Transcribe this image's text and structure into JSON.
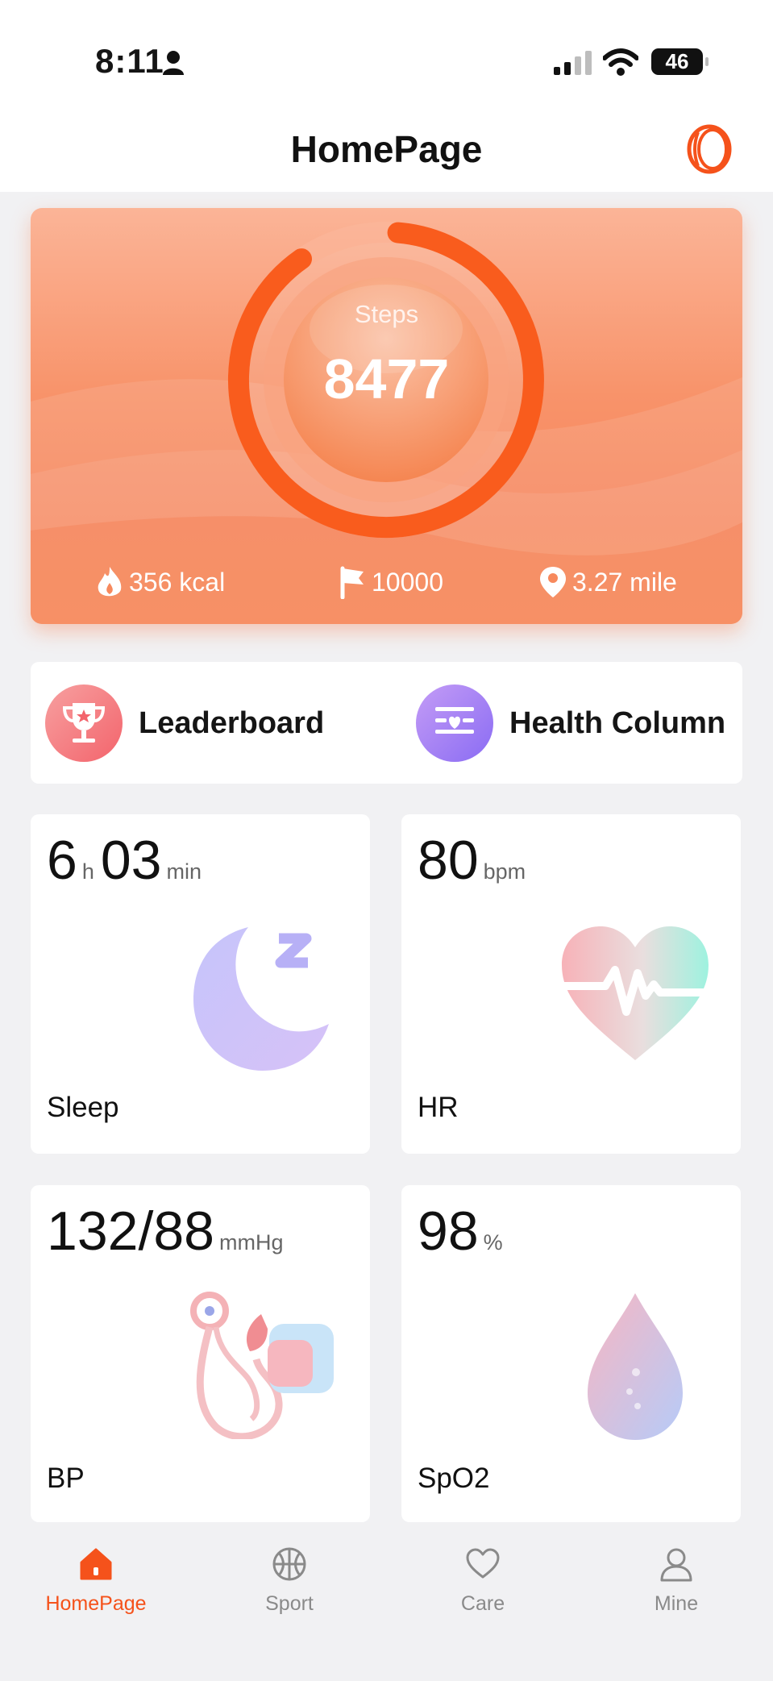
{
  "status_bar": {
    "time": "8:11",
    "battery": "46"
  },
  "header": {
    "title": "HomePage"
  },
  "steps_card": {
    "label": "Steps",
    "value": "8477",
    "goal_progress": 0.8477,
    "stats": {
      "calories": "356 kcal",
      "goal": "10000",
      "distance": "3.27 mile"
    }
  },
  "quick_links": [
    {
      "label": "Leaderboard"
    },
    {
      "label": "Health Column"
    }
  ],
  "tiles": {
    "sleep": {
      "hours": "6",
      "hours_unit": "h",
      "minutes": "03",
      "minutes_unit": "min",
      "label": "Sleep"
    },
    "hr": {
      "value": "80",
      "unit": "bpm",
      "label": "HR"
    },
    "bp": {
      "value": "132/88",
      "unit": "mmHg",
      "label": "BP"
    },
    "spo2": {
      "value": "98",
      "unit": "%",
      "label": "SpO2"
    }
  },
  "tabs": [
    {
      "label": "HomePage",
      "active": true
    },
    {
      "label": "Sport",
      "active": false
    },
    {
      "label": "Care",
      "active": false
    },
    {
      "label": "Mine",
      "active": false
    }
  ],
  "colors": {
    "accent": "#f5521b",
    "card_top": "#fbb497",
    "card_bottom": "#f88957",
    "tab_inactive": "#8a8a8a"
  }
}
